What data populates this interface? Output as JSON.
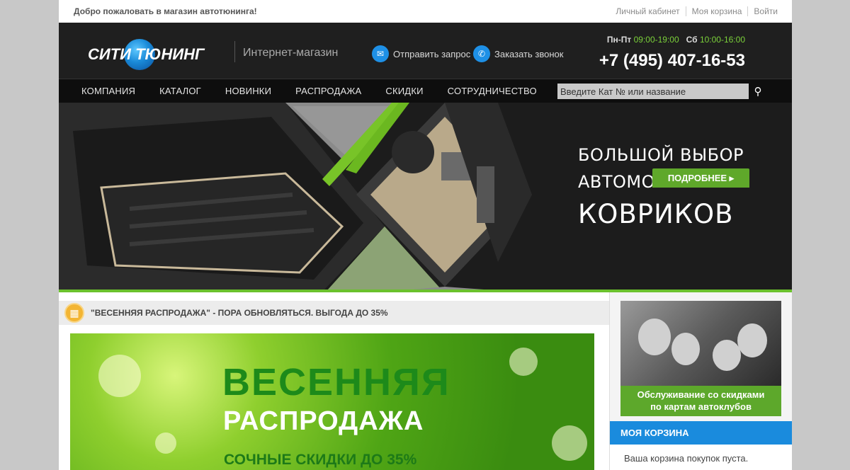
{
  "topbar": {
    "welcome": "Добро пожаловать в магазин автотюнинга!",
    "links": [
      "Личный кабинет",
      "Моя корзина",
      "Войти"
    ]
  },
  "header": {
    "logo_text": "СИТИ ТЮНИНГ",
    "logo_subtitle": "Интернет-магазин",
    "send_request": "Отправить запрос",
    "order_call": "Заказать звонок",
    "hours_weekdays_label": "Пн-Пт",
    "hours_weekdays": "09:00-19:00",
    "hours_sat_label": "Сб",
    "hours_sat": "10:00-16:00",
    "phone": "+7 (495) 407-16-53"
  },
  "nav": {
    "items": [
      "КОМПАНИЯ",
      "КАТАЛОГ",
      "НОВИНКИ",
      "РАСПРОДАЖА",
      "СКИДКИ",
      "СОТРУДНИЧЕСТВО"
    ],
    "search_placeholder": "Введите Кат № или название"
  },
  "banner": {
    "line1": "БОЛЬШОЙ ВЫБОР",
    "line2": "АВТОМОБИЛЬНЫХ",
    "line3": "КОВРИКОВ",
    "more_button": "ПОДРОБНЕЕ ▸"
  },
  "promo": {
    "title": "\"ВЕСЕННЯЯ РАСПРОДАЖА\" - ПОРА ОБНОВЛЯТЬСЯ. ВЫГОДА ДО 35%",
    "image_line1": "ВЕСЕННЯЯ",
    "image_line2": "РАСПРОДАЖА",
    "image_line3": "СОЧНЫЕ СКИДКИ ДО 35%"
  },
  "sidebar": {
    "ad_line1": "Обслуживание  со скидками",
    "ad_line2": "по картам автоклубов",
    "cart_title": "МОЯ КОРЗИНА",
    "cart_empty": "Ваша корзина покупок пуста."
  },
  "colors": {
    "accent_green": "#6bc12d",
    "accent_blue": "#1a8bdd",
    "header_bg": "#1f1f1f"
  }
}
